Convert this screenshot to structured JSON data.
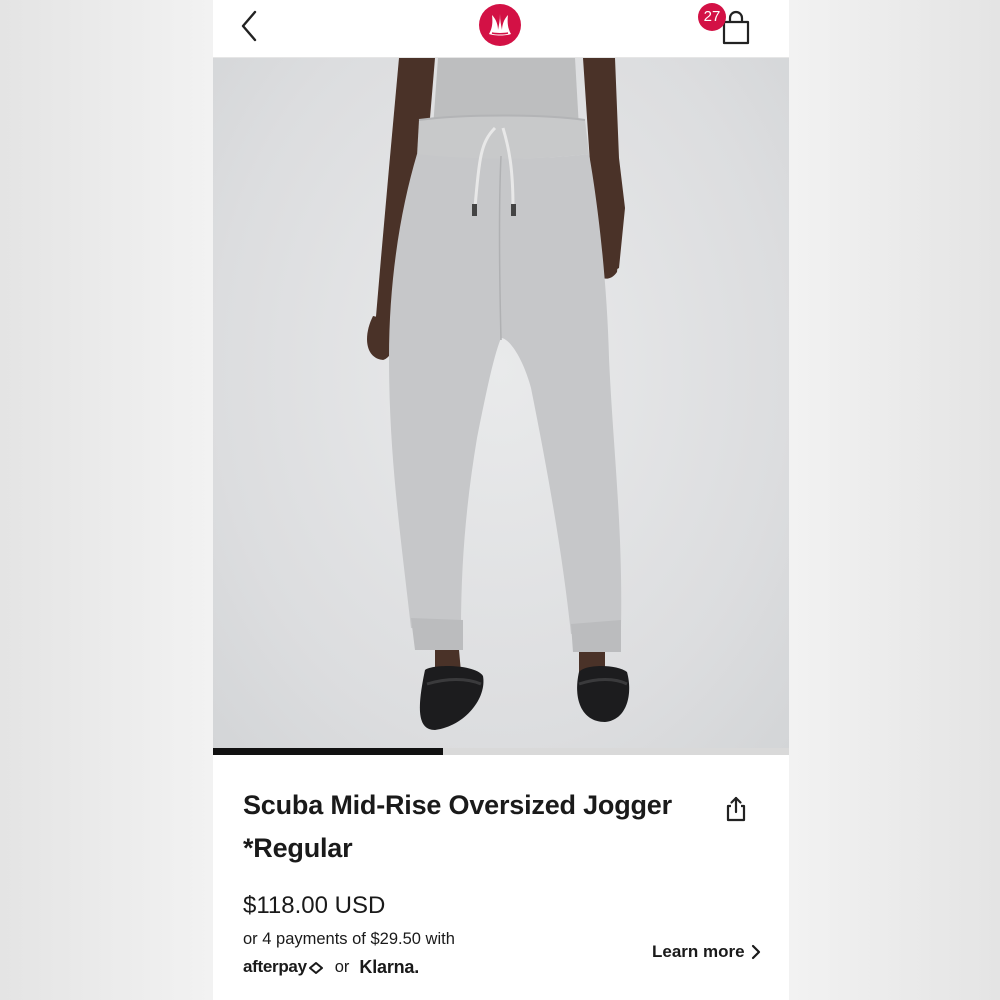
{
  "header": {
    "back_icon": "chevron-left-icon",
    "logo_icon": "lululemon-logo-icon",
    "bag_icon": "shopping-bag-icon",
    "bag_count": "27",
    "brand_color": "#d31145"
  },
  "gallery": {
    "progress_fraction": 0.4
  },
  "product": {
    "title": "Scuba Mid-Rise Oversized Jogger *Regular",
    "share_icon": "share-icon",
    "price": "$118.00 USD",
    "installments": "or 4 payments of $29.50 with",
    "afterpay": "afterpay",
    "or": "or",
    "klarna": "Klarna.",
    "learn_more": "Learn more"
  }
}
